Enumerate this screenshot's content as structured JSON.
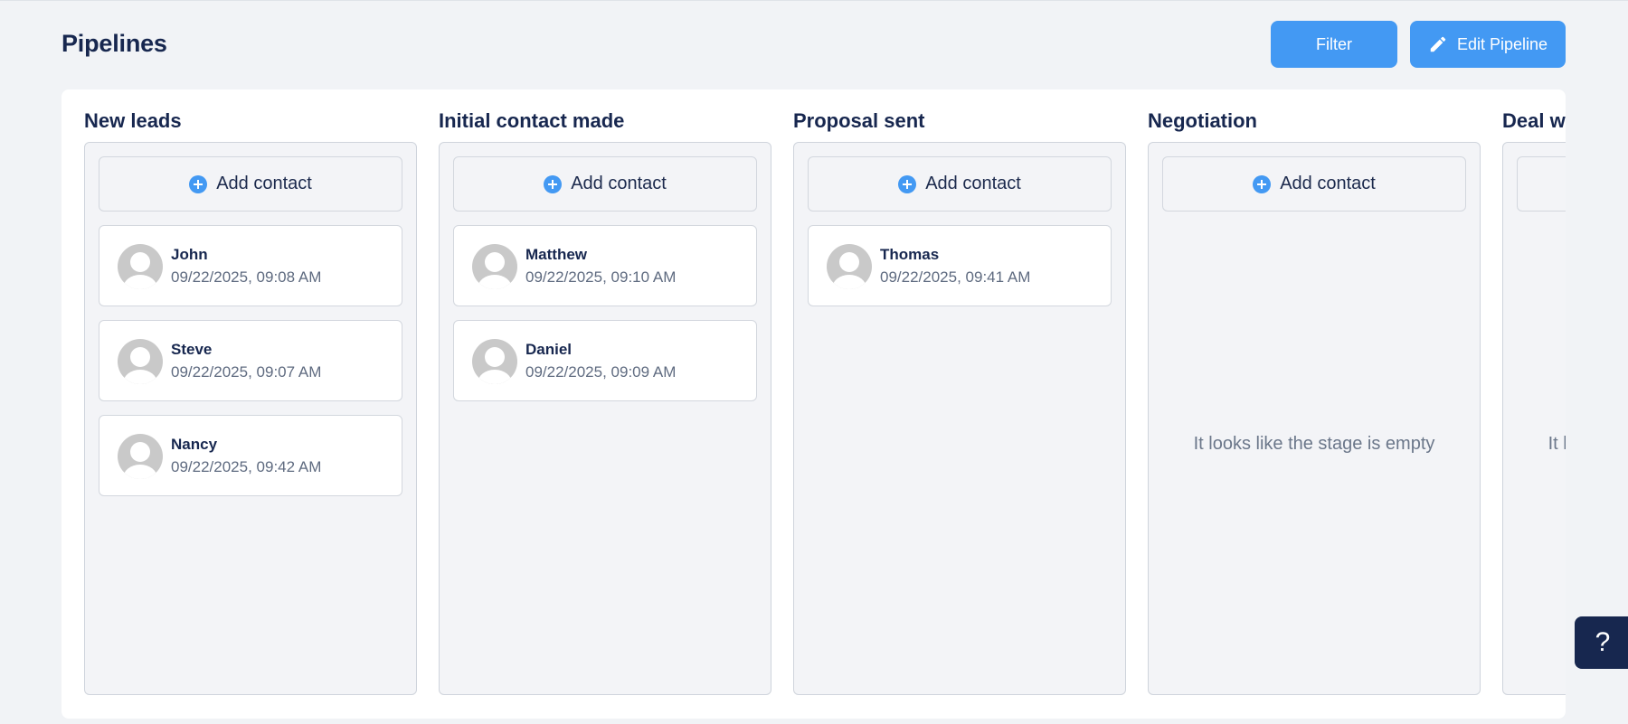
{
  "header": {
    "title": "Pipelines",
    "filter_label": "Filter",
    "edit_label": "Edit Pipeline"
  },
  "add_contact_label": "Add contact",
  "columns": [
    {
      "title": "New leads",
      "cards": [
        {
          "name": "John",
          "date": "09/22/2025, 09:08 AM"
        },
        {
          "name": "Steve",
          "date": "09/22/2025, 09:07 AM"
        },
        {
          "name": "Nancy",
          "date": "09/22/2025, 09:42 AM"
        }
      ]
    },
    {
      "title": "Initial contact made",
      "cards": [
        {
          "name": "Matthew",
          "date": "09/22/2025, 09:10 AM"
        },
        {
          "name": "Daniel",
          "date": "09/22/2025, 09:09 AM"
        }
      ]
    },
    {
      "title": "Proposal sent",
      "cards": [
        {
          "name": "Thomas",
          "date": "09/22/2025, 09:41 AM"
        }
      ]
    },
    {
      "title": "Negotiation",
      "cards": [],
      "empty_text": "It looks like the stage is empty"
    },
    {
      "title": "Deal won",
      "cards": [],
      "empty_text": "It looks like the stage is empty"
    }
  ],
  "help": {
    "label": "?"
  },
  "colors": {
    "accent": "#4399f3",
    "navy": "#17274f",
    "background": "#f1f3f6"
  }
}
